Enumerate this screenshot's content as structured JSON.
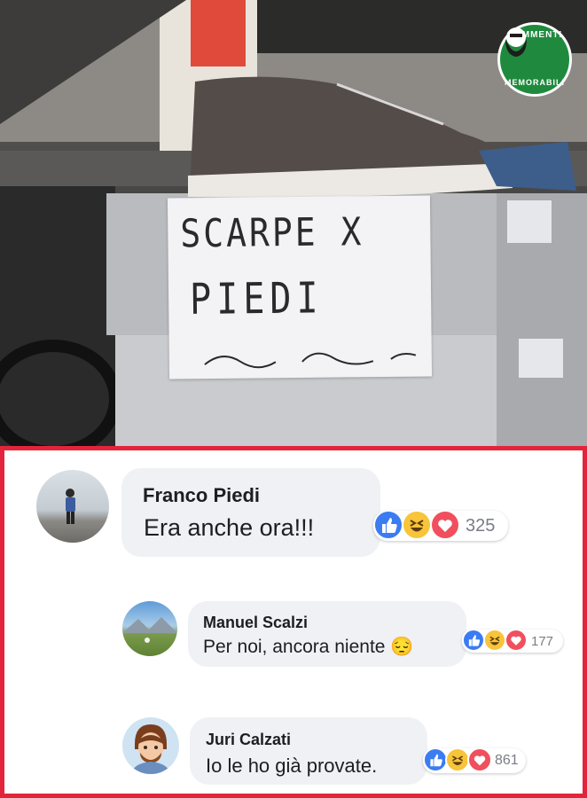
{
  "photo": {
    "sign_line1": "SCARPE X",
    "sign_line2": "PIEDI",
    "watermark": {
      "top_text": "COMMENTI",
      "bottom_text": "MEMORABILI"
    }
  },
  "comments": [
    {
      "author": "Franco Piedi",
      "text": "Era anche ora!!!",
      "reaction_count": "325",
      "reactions": [
        "like-icon",
        "haha-icon",
        "love-icon"
      ]
    },
    {
      "author": "Manuel Scalzi",
      "text": "Per noi, ancora niente 😔",
      "reaction_count": "177",
      "reactions": [
        "like-icon",
        "haha-icon",
        "love-icon"
      ]
    },
    {
      "author": "Juri Calzati",
      "text": "Io le ho già provate.",
      "reaction_count": "861",
      "reactions": [
        "like-icon",
        "haha-icon",
        "love-icon"
      ]
    }
  ],
  "colors": {
    "frame": "#e2253a",
    "bubble": "#f0f1f4",
    "like": "#3b7cf2",
    "haha": "#f7c43a",
    "love": "#f04f5d",
    "badge": "#1f8a3e"
  }
}
